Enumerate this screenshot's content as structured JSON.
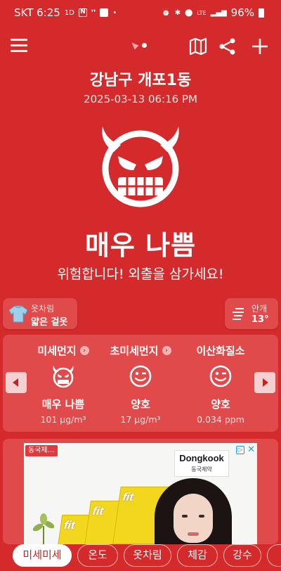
{
  "status_bar": {
    "carrier_time": "SKT 6:25",
    "battery": "96%",
    "lte": "LTE"
  },
  "header": {
    "location": "강남구 개포1동",
    "datetime": "2025-03-13 06:16 PM",
    "overall_grade": "매우 나쁨",
    "message": "위험합니다! 외출을 삼가세요!"
  },
  "chips": {
    "clothing_label": "옷차림",
    "clothing_value": "얇은 겉옷",
    "fog_label": "안개",
    "fog_value": "13°"
  },
  "pollutants": [
    {
      "name": "미세먼지",
      "info": "›",
      "grade": "매우 나쁨",
      "value": "101 μg/m³",
      "icon": "devil-face-icon"
    },
    {
      "name": "초미세먼지",
      "info": "›",
      "grade": "양호",
      "value": "17 μg/m³",
      "icon": "wink-face-icon"
    },
    {
      "name": "이산화질소",
      "info": "",
      "grade": "양호",
      "value": "0.034 ppm",
      "icon": "wink-face-icon"
    }
  ],
  "ad": {
    "badge": "동국제…",
    "brand": "Dongkook",
    "brand_sub": "동국제약",
    "product_text": "fit",
    "choice": "▷",
    "close": "✕"
  },
  "tabs": [
    {
      "label": "미세미세",
      "active": true
    },
    {
      "label": "온도",
      "active": false
    },
    {
      "label": "옷차림",
      "active": false
    },
    {
      "label": "체감",
      "active": false
    },
    {
      "label": "강수",
      "active": false
    }
  ],
  "colors": {
    "background": "#d42a2c",
    "card": "#e04a4b",
    "accent_text": "#ffffff"
  }
}
